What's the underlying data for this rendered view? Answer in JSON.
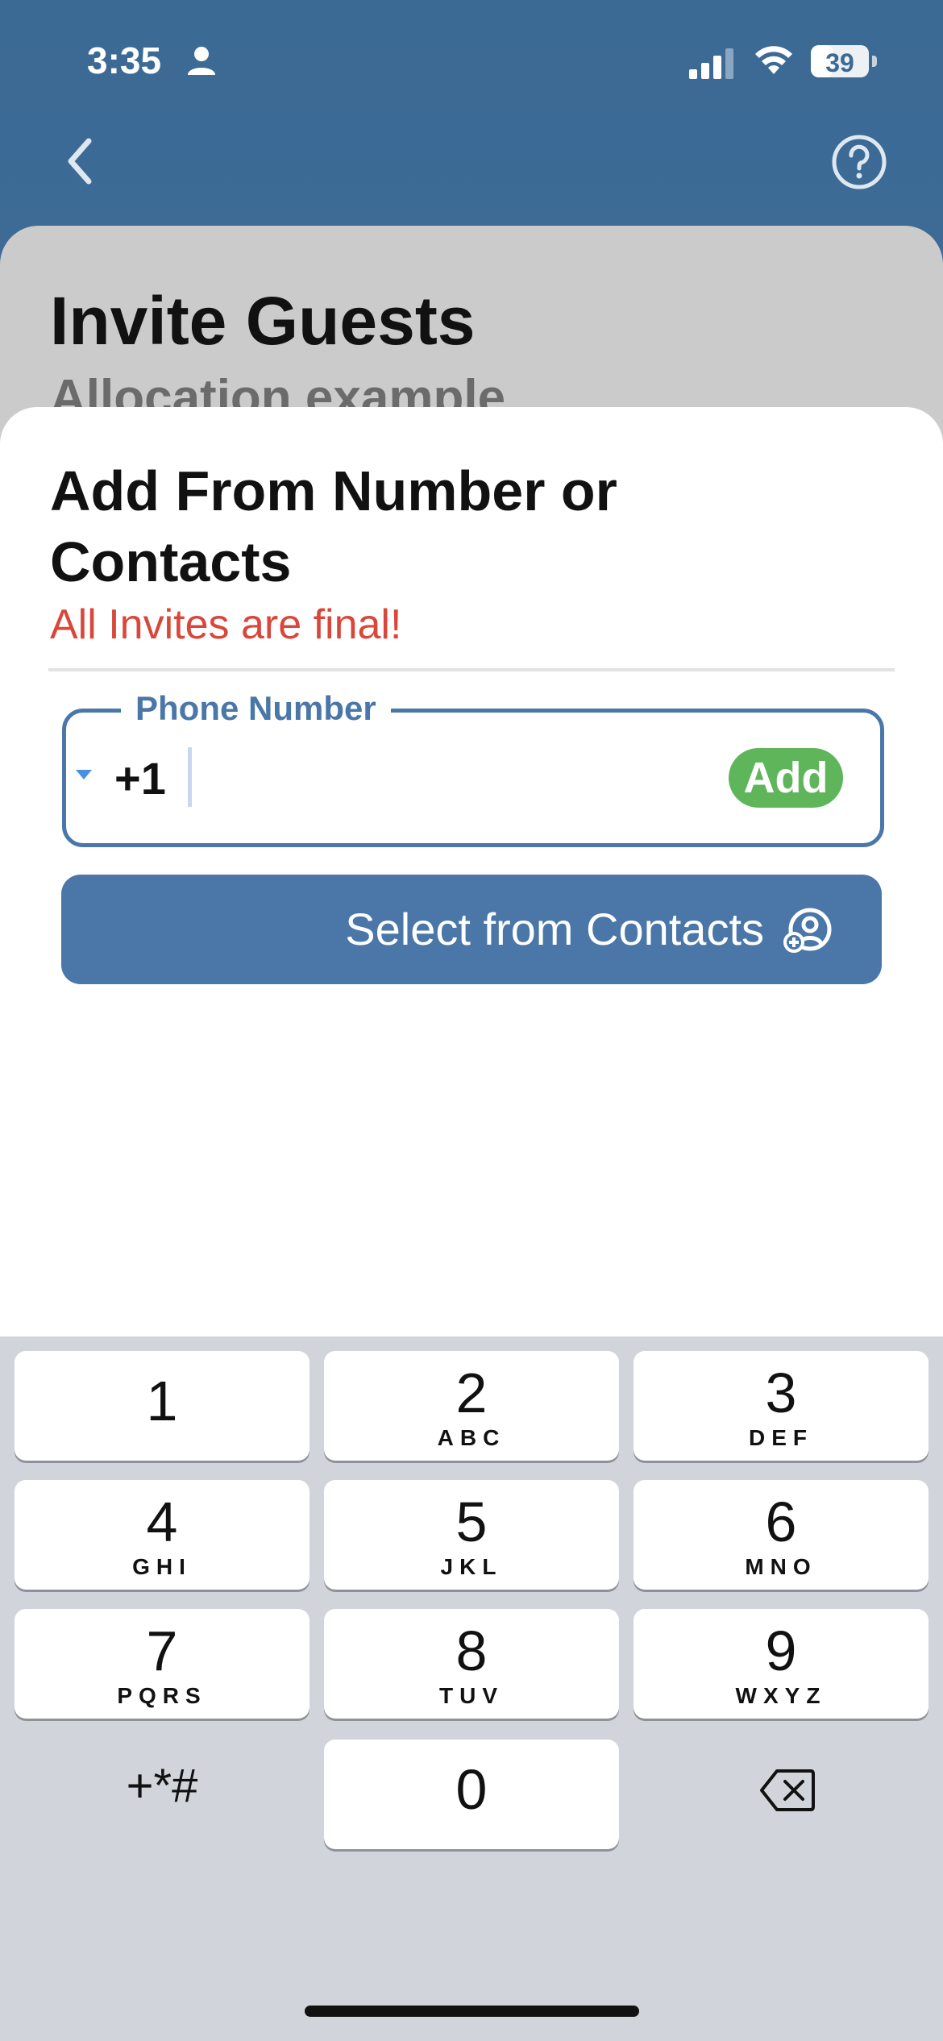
{
  "status_bar": {
    "time": "3:35",
    "battery": "39",
    "battery_level": 0.39
  },
  "nav": {
    "back_icon": "chevron-left-icon",
    "help_icon": "question-circle-icon"
  },
  "page": {
    "title": "Invite Guests",
    "subtitle": "Allocation example"
  },
  "modal": {
    "title": "Add From Number or Contacts",
    "warning": "All Invites are final!",
    "phone_field": {
      "label": "Phone Number",
      "country_code": "+1",
      "value": "",
      "add_label": "Add"
    },
    "contacts_button_label": "Select from Contacts"
  },
  "keyboard": {
    "keys": [
      {
        "num": "1",
        "letters": ""
      },
      {
        "num": "2",
        "letters": "ABC"
      },
      {
        "num": "3",
        "letters": "DEF"
      },
      {
        "num": "4",
        "letters": "GHI"
      },
      {
        "num": "5",
        "letters": "JKL"
      },
      {
        "num": "6",
        "letters": "MNO"
      },
      {
        "num": "7",
        "letters": "PQRS"
      },
      {
        "num": "8",
        "letters": "TUV"
      },
      {
        "num": "9",
        "letters": "WXYZ"
      },
      {
        "num": "0",
        "letters": ""
      }
    ],
    "symbols": "+*#"
  },
  "colors": {
    "header": "#3b6a95",
    "accent": "#4a77a8",
    "warning": "#d9473b",
    "add_button": "#5fb55a"
  }
}
